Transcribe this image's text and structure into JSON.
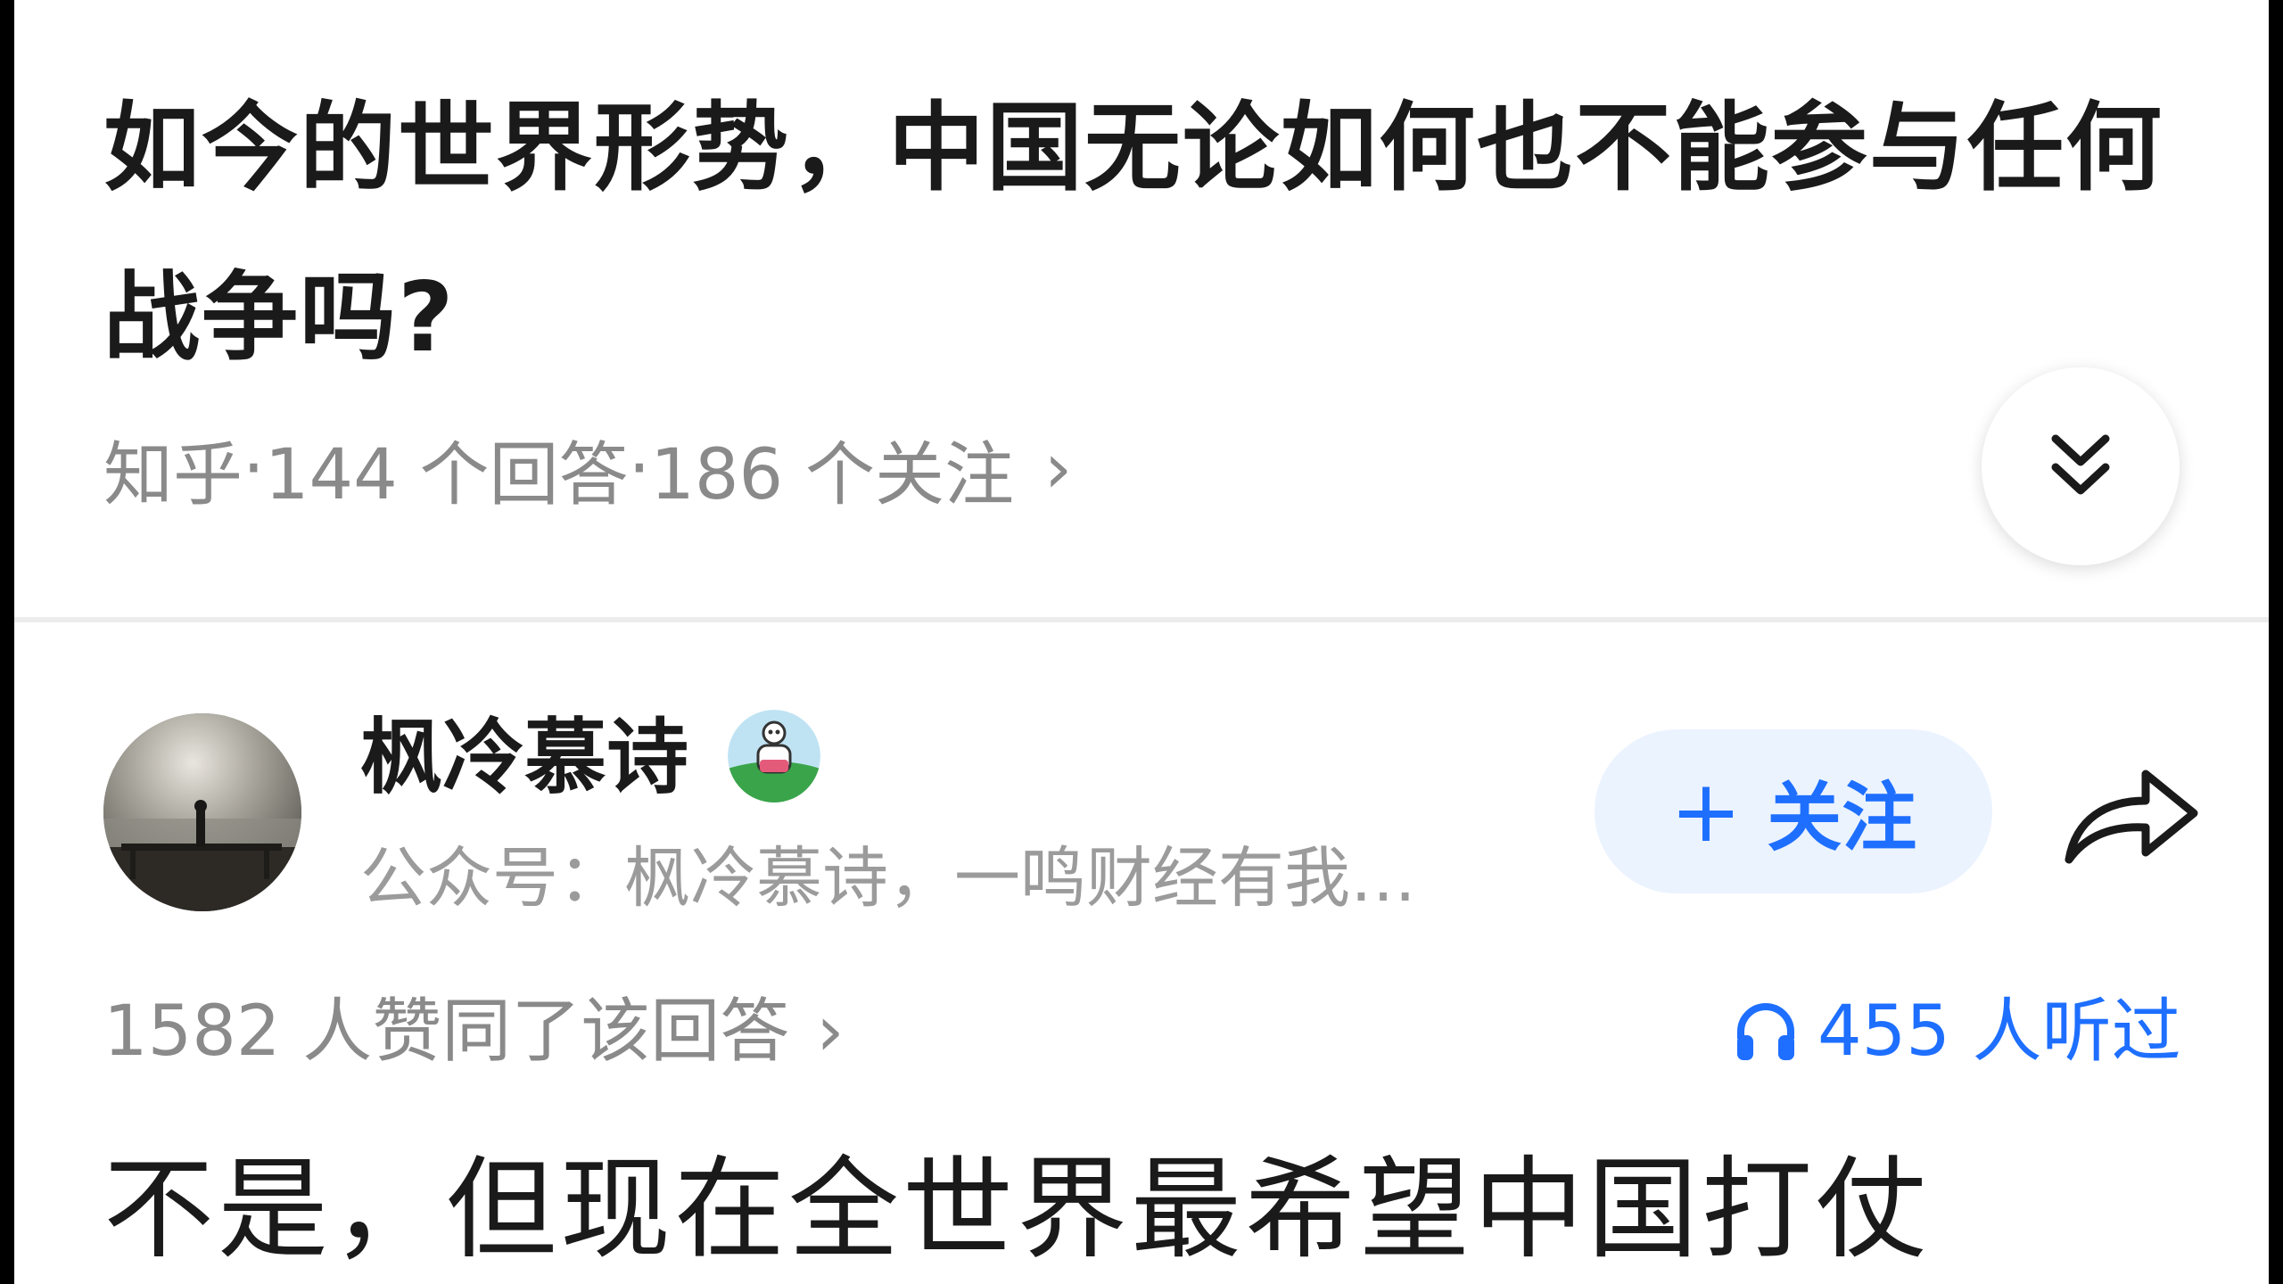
{
  "question": {
    "title": "如今的世界形势，中国无论如何也不能参与任何战争吗?",
    "source": "知乎",
    "sep": " · ",
    "answers_count": "144 个回答",
    "followers_count": "186 个关注",
    "meta_chevron": "›",
    "collapse_icon": "double-chevron-down-icon"
  },
  "author": {
    "name": "枫冷慕诗",
    "bio": "公众号：枫冷慕诗，一鸣财经有我…",
    "follow_plus": "+",
    "follow_label": "关注",
    "share_icon": "share-arrow-icon"
  },
  "stats": {
    "upvotes": "1582 人赞同了该回答",
    "upvotes_chevron": "›",
    "listened": "455 人听过",
    "listened_icon": "headphones-icon"
  },
  "answer": {
    "first_line": "不是，但现在全世界最希望中国打仗"
  },
  "colors": {
    "accent": "#1e6fff",
    "follow_bg": "#ebf3ff",
    "meta_text": "#8a8a8a"
  }
}
